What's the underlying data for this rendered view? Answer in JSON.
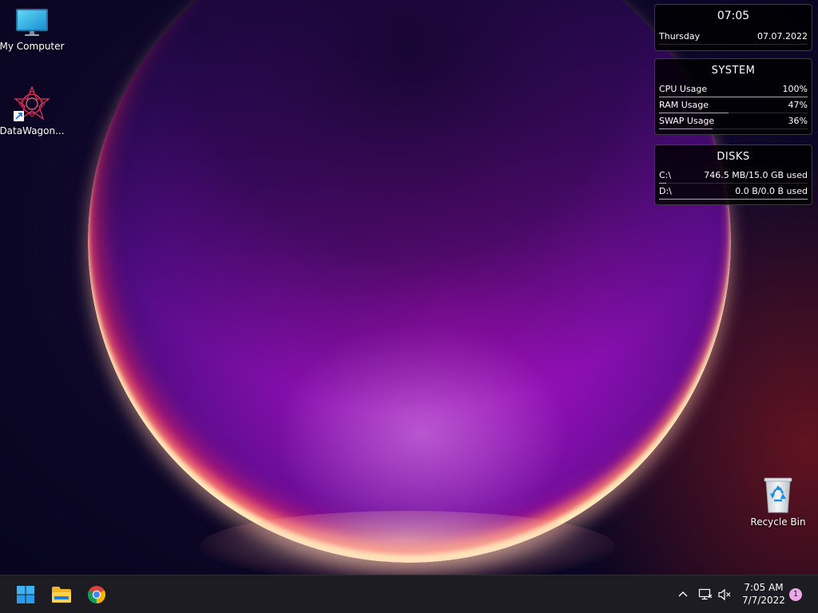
{
  "desktop": {
    "icons": [
      {
        "label": "My Computer",
        "icon": "monitor-icon"
      },
      {
        "label": "DataWagon...",
        "icon": "datawagon-logo-icon"
      },
      {
        "label": "Recycle Bin",
        "icon": "recycle-bin-icon"
      }
    ]
  },
  "widgets": {
    "clock": {
      "time": "07:05",
      "day": "Thursday",
      "date": "07.07.2022"
    },
    "system": {
      "title": "SYSTEM",
      "rows": [
        {
          "label": "CPU Usage",
          "value": "100%",
          "level": 1.0
        },
        {
          "label": "RAM Usage",
          "value": "47%",
          "level": 0.47
        },
        {
          "label": "SWAP Usage",
          "value": "36%",
          "level": 0.36
        }
      ]
    },
    "disks": {
      "title": "DISKS",
      "rows": [
        {
          "label": "C:\\",
          "value": "746.5 MB/15.0 GB used",
          "level": 0.05
        },
        {
          "label": "D:\\",
          "value": "0.0 B/0.0 B used",
          "level": 1.0
        }
      ]
    },
    "bar_color": "#e59a61"
  },
  "taskbar": {
    "apps": [
      {
        "name": "start",
        "icon": "windows-start-icon"
      },
      {
        "name": "file-explorer",
        "icon": "folder-icon"
      },
      {
        "name": "chrome",
        "icon": "chrome-icon"
      }
    ],
    "tray": {
      "time": "7:05 AM",
      "date": "7/7/2022",
      "notifications": "1",
      "icons": [
        "chevron-up-icon",
        "network-icon",
        "volume-muted-icon"
      ]
    }
  }
}
